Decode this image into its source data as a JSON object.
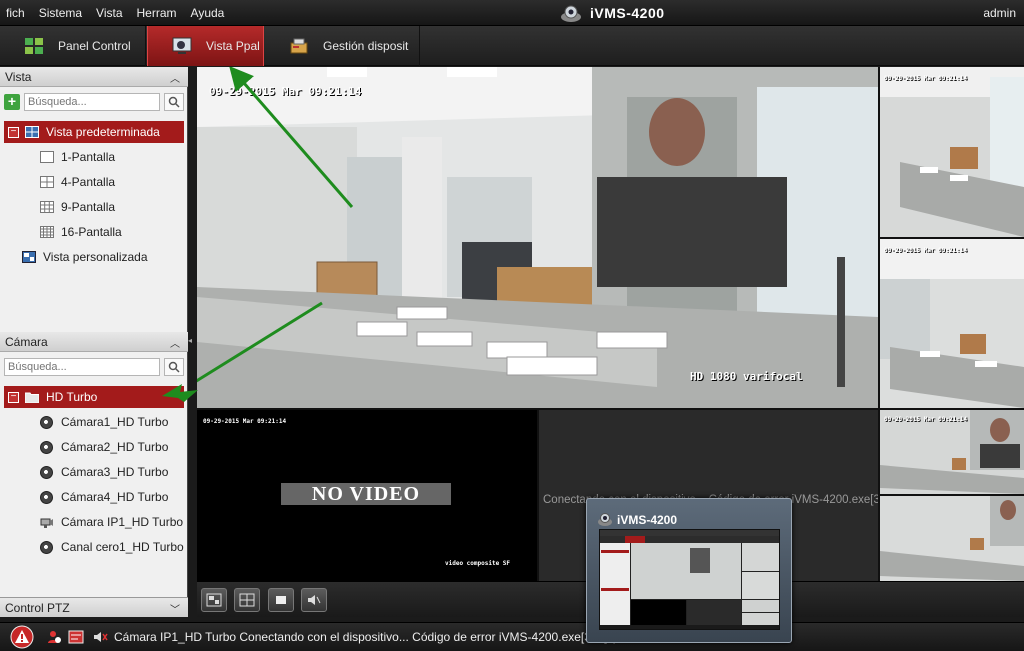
{
  "menu": [
    "fich",
    "Sistema",
    "Vista",
    "Herram",
    "Ayuda"
  ],
  "app_title": "iVMS-4200",
  "user": "admin",
  "tabs": [
    {
      "label": "Panel Control",
      "active": false
    },
    {
      "label": "Vista Ppal",
      "active": true
    },
    {
      "label": "Gestión disposit",
      "active": false
    }
  ],
  "vista_panel": {
    "header": "Vista",
    "search_placeholder": "Búsqueda...",
    "root": "Vista predeterminada",
    "items": [
      "1-Pantalla",
      "4-Pantalla",
      "9-Pantalla",
      "16-Pantalla"
    ],
    "custom": "Vista personalizada"
  },
  "camera_panel": {
    "header": "Cámara",
    "search_placeholder": "Búsqueda...",
    "group": "HD Turbo",
    "cameras": [
      "Cámara1_HD Turbo",
      "Cámara2_HD Turbo",
      "Cámara3_HD Turbo",
      "Cámara4_HD Turbo",
      "Cámara IP1_HD Turbo",
      "Canal cero1_HD Turbo"
    ]
  },
  "ptz_panel": {
    "header": "Control PTZ"
  },
  "video": {
    "main_timestamp": "09-29-2015 Mar 09:21:14",
    "main_label": "HD 1080 varifocal",
    "small_timestamp": "09-29-2015 Mar 09:21:14",
    "no_video": "NO VIDEO",
    "no_video_caption": "video composite SF",
    "connecting": "Conectando con el dispositivo... Código de error iVMS-4200.exe[30..."
  },
  "status": {
    "message": "Cámara IP1_HD Turbo Conectando con el dispositivo... Código de error iVMS-4200.exe[302].(Cá"
  },
  "preview": {
    "title": "iVMS-4200"
  },
  "colors": {
    "accent": "#a31b1b",
    "background": "#1b1b1b",
    "arrow": "#1e8c1e"
  }
}
